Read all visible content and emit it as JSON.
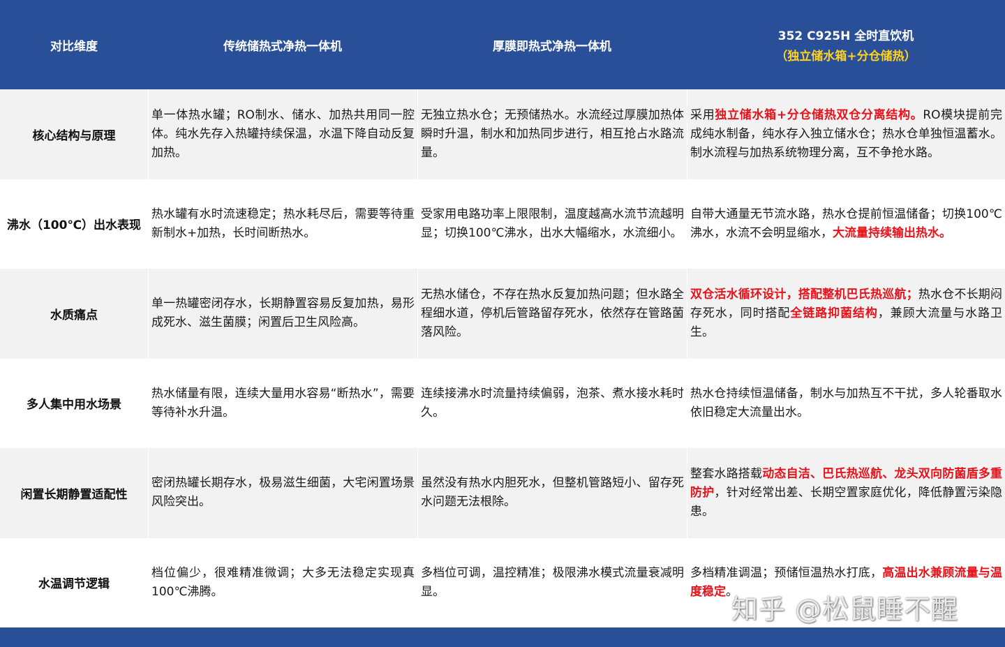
{
  "header": {
    "col0": "对比维度",
    "col1": "传统储热式净热一体机",
    "col2": "厚膜即热式净热一体机",
    "col3_title": "352 C925H 全时直饮机",
    "col3_sub": "（独立储水箱+分仓储热）"
  },
  "rows": [
    {
      "dim": "核心结构与原理",
      "c1": "单一体热水罐；RO制水、储水、加热共用同一腔体。纯水先存入热罐持续保温，水温下降自动反复加热。",
      "c2": "无独立热水仓；无预储热水。水流经过厚膜加热体瞬时升温，制水和加热同步进行，相互抢占水路流量。",
      "c3": [
        {
          "t": "采用",
          "h": false
        },
        {
          "t": "独立储水箱+分仓储热双仓分离结构。",
          "h": true
        },
        {
          "t": "RO模块提前完成纯水制备，纯水存入独立储水仓；热水仓单独恒温蓄水。制水流程与加热系统物理分离，互不争抢水路。",
          "h": false
        }
      ]
    },
    {
      "dim": "沸水（100℃）出水表现",
      "c1": "热水罐有水时流速稳定；热水耗尽后，需要等待重新制水+加热，长时间断热水。",
      "c2": "受家用电路功率上限限制，温度越高水流节流越明显；切换100℃沸水，出水大幅缩水，水流细小。",
      "c3": [
        {
          "t": "自带大通量无节流水路，热水仓提前恒温储备；切换100℃沸水，水流不会明显缩水，",
          "h": false
        },
        {
          "t": "大流量持续输出热水。",
          "h": true
        }
      ]
    },
    {
      "dim": "水质痛点",
      "c1": "单一热罐密闭存水，长期静置容易反复加热，易形成死水、滋生菌膜；闲置后卫生风险高。",
      "c2": "无热水储仓，不存在热水反复加热问题；但水路全程细水道，停机后管路留存死水，依然存在管路菌落风险。",
      "c3": [
        {
          "t": "双仓活水循环设计，搭配整机巴氏热巡航；",
          "h": true
        },
        {
          "t": "热水仓不长期闷存死水，同时搭配",
          "h": false
        },
        {
          "t": "全链路抑菌结构",
          "h": true
        },
        {
          "t": "，兼顾大流量与水路卫生。",
          "h": false
        }
      ]
    },
    {
      "dim": "多人集中用水场景",
      "c1": "热水储量有限，连续大量用水容易“断热水”，需要等待补水升温。",
      "c2": "连续接沸水时流量持续偏弱，泡茶、煮水接水耗时久。",
      "c3": [
        {
          "t": "热水仓持续恒温储备，制水与加热互不干扰，多人轮番取水依旧稳定大流量出水。",
          "h": false
        }
      ]
    },
    {
      "dim": "闲置长期静置适配性",
      "c1": "密闭热罐长期存水，极易滋生细菌，大宅闲置场景风险突出。",
      "c2": "虽然没有热水内胆死水，但整机管路短小、留存死水问题无法根除。",
      "c3": [
        {
          "t": "整套水路搭载",
          "h": false
        },
        {
          "t": "动态自洁、巴氏热巡航、龙头双向防菌盾多重防护",
          "h": true
        },
        {
          "t": "，针对经常出差、长期空置家庭优化，降低静置污染隐患。",
          "h": false
        }
      ]
    },
    {
      "dim": "水温调节逻辑",
      "c1": "档位偏少，很难精准微调；大多无法稳定实现真100℃沸腾。",
      "c2": "多档位可调，温控精准；极限沸水模式流量衰减明显。",
      "c3": [
        {
          "t": "多档精准调温；预储恒温热水打底，",
          "h": false
        },
        {
          "t": "高温出水兼顾流量与温度稳定",
          "h": true
        },
        {
          "t": "。",
          "h": false
        }
      ]
    }
  ],
  "watermark": "知乎 @松鼠睡不醒",
  "colors": {
    "header_bg": "#2a4f99",
    "header_sub": "#ffd21f",
    "highlight": "#e8121b",
    "row_gray": "#f2f2f2"
  }
}
